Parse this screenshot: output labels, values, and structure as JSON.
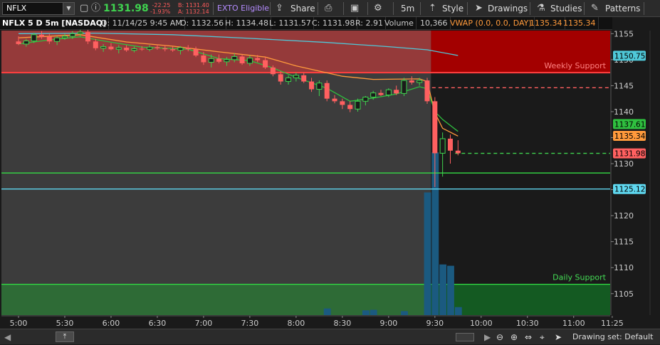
{
  "toolbar": {
    "symbol": "NFLX",
    "last_price": "1131.98",
    "net_change": "-22.25",
    "pct_change": "-1.93%",
    "bid": "B: 1131.40",
    "ask": "A: 1132.14",
    "exto_label": "EXTO Eligible",
    "share_label": "Share",
    "timeframe_label": "5m",
    "style_label": "Style",
    "drawings_label": "Drawings",
    "studies_label": "Studies",
    "patterns_label": "Patterns"
  },
  "header": {
    "title": "NFLX 5 D 5m [NASDAQ]",
    "date": "D: 11/14/25 9:45 AM",
    "open": "O: 1132.56",
    "high": "H: 1134.48",
    "low": "L: 1131.57",
    "close": "C: 1131.98",
    "range": "R: 2.91",
    "volume_label": "Volume",
    "volume_value": "10,366",
    "vwap_label": "VWAP (0.0, 0.0, DAY)",
    "vwap_value1": "1135.34",
    "vwap_value2": "1135.34"
  },
  "bottom": {
    "drawing_set": "Drawing set: Default"
  },
  "colors": {
    "up": "#3fd34f",
    "down": "#ff6060",
    "ema_fast": "#2fbf3f",
    "ema_slow": "#ff9a3c",
    "ma_long": "#4fc8d8",
    "support": "#33dd44",
    "cyan": "#5fd8f0"
  },
  "chart_data": {
    "type": "candlestick",
    "ylim": [
      1101,
      1156
    ],
    "y_ticks": [
      1105,
      1110,
      1115,
      1120,
      1125,
      1130,
      1135,
      1140,
      1145,
      1150,
      1155
    ],
    "x_ticks": [
      {
        "label": "5:00",
        "t": 0
      },
      {
        "label": "5:30",
        "t": 6
      },
      {
        "label": "6:00",
        "t": 12
      },
      {
        "label": "6:30",
        "t": 18
      },
      {
        "label": "7:00",
        "t": 24
      },
      {
        "label": "7:30",
        "t": 30
      },
      {
        "label": "8:00",
        "t": 36
      },
      {
        "label": "8:30",
        "t": 42
      },
      {
        "label": "9:00",
        "t": 48
      },
      {
        "label": "9:30",
        "t": 54
      },
      {
        "label": "10:00",
        "t": 60
      },
      {
        "label": "10:30",
        "t": 66
      },
      {
        "label": "11:00",
        "t": 72
      },
      {
        "label": "11:25",
        "t": 77
      }
    ],
    "session_open_t": 53,
    "candles": [
      {
        "t": 0,
        "o": 1153.5,
        "h": 1154.5,
        "l": 1152.8,
        "c": 1153.0
      },
      {
        "t": 1,
        "o": 1153.0,
        "h": 1154.0,
        "l": 1152.5,
        "c": 1153.6
      },
      {
        "t": 2,
        "o": 1153.6,
        "h": 1155.2,
        "l": 1153.2,
        "c": 1154.8
      },
      {
        "t": 3,
        "o": 1154.8,
        "h": 1155.5,
        "l": 1154.0,
        "c": 1154.4
      },
      {
        "t": 4,
        "o": 1154.4,
        "h": 1155.0,
        "l": 1153.0,
        "c": 1153.5
      },
      {
        "t": 5,
        "o": 1153.5,
        "h": 1154.5,
        "l": 1152.8,
        "c": 1154.2
      },
      {
        "t": 6,
        "o": 1154.2,
        "h": 1155.0,
        "l": 1153.8,
        "c": 1154.5
      },
      {
        "t": 7,
        "o": 1154.5,
        "h": 1155.5,
        "l": 1154.0,
        "c": 1155.0
      },
      {
        "t": 8,
        "o": 1155.0,
        "h": 1155.8,
        "l": 1154.5,
        "c": 1155.3
      },
      {
        "t": 9,
        "o": 1155.3,
        "h": 1155.8,
        "l": 1153.0,
        "c": 1153.5
      },
      {
        "t": 10,
        "o": 1153.5,
        "h": 1154.0,
        "l": 1151.8,
        "c": 1152.2
      },
      {
        "t": 11,
        "o": 1152.2,
        "h": 1153.0,
        "l": 1151.5,
        "c": 1152.5
      },
      {
        "t": 12,
        "o": 1152.5,
        "h": 1153.2,
        "l": 1151.8,
        "c": 1152.0
      },
      {
        "t": 13,
        "o": 1152.0,
        "h": 1152.8,
        "l": 1151.2,
        "c": 1152.3
      },
      {
        "t": 14,
        "o": 1152.3,
        "h": 1152.8,
        "l": 1151.5,
        "c": 1151.8
      },
      {
        "t": 15,
        "o": 1151.8,
        "h": 1152.5,
        "l": 1151.4,
        "c": 1152.1
      },
      {
        "t": 16,
        "o": 1152.1,
        "h": 1152.6,
        "l": 1151.7,
        "c": 1152.0
      },
      {
        "t": 17,
        "o": 1152.0,
        "h": 1152.8,
        "l": 1151.6,
        "c": 1152.4
      },
      {
        "t": 18,
        "o": 1152.4,
        "h": 1152.9,
        "l": 1151.9,
        "c": 1152.2
      },
      {
        "t": 19,
        "o": 1152.2,
        "h": 1152.8,
        "l": 1151.6,
        "c": 1152.0
      },
      {
        "t": 20,
        "o": 1152.0,
        "h": 1152.5,
        "l": 1151.5,
        "c": 1151.8
      },
      {
        "t": 21,
        "o": 1151.8,
        "h": 1152.6,
        "l": 1151.0,
        "c": 1152.3
      },
      {
        "t": 22,
        "o": 1152.3,
        "h": 1152.8,
        "l": 1151.6,
        "c": 1152.0
      },
      {
        "t": 23,
        "o": 1152.0,
        "h": 1152.5,
        "l": 1150.5,
        "c": 1150.8
      },
      {
        "t": 24,
        "o": 1150.8,
        "h": 1151.5,
        "l": 1149.0,
        "c": 1149.5
      },
      {
        "t": 25,
        "o": 1149.5,
        "h": 1151.0,
        "l": 1148.5,
        "c": 1150.2
      },
      {
        "t": 26,
        "o": 1150.2,
        "h": 1151.0,
        "l": 1149.3,
        "c": 1149.6
      },
      {
        "t": 27,
        "o": 1149.6,
        "h": 1150.5,
        "l": 1148.8,
        "c": 1150.0
      },
      {
        "t": 28,
        "o": 1150.0,
        "h": 1151.2,
        "l": 1149.5,
        "c": 1150.6
      },
      {
        "t": 29,
        "o": 1150.6,
        "h": 1151.0,
        "l": 1149.0,
        "c": 1149.3
      },
      {
        "t": 30,
        "o": 1149.3,
        "h": 1150.8,
        "l": 1148.8,
        "c": 1150.3
      },
      {
        "t": 31,
        "o": 1150.3,
        "h": 1150.9,
        "l": 1149.5,
        "c": 1149.9
      },
      {
        "t": 32,
        "o": 1149.9,
        "h": 1150.5,
        "l": 1148.2,
        "c": 1148.5
      },
      {
        "t": 33,
        "o": 1148.5,
        "h": 1148.9,
        "l": 1146.8,
        "c": 1147.2
      },
      {
        "t": 34,
        "o": 1147.2,
        "h": 1147.8,
        "l": 1145.2,
        "c": 1145.8
      },
      {
        "t": 35,
        "o": 1145.8,
        "h": 1147.0,
        "l": 1145.2,
        "c": 1146.5
      },
      {
        "t": 36,
        "o": 1146.5,
        "h": 1147.5,
        "l": 1145.8,
        "c": 1147.0
      },
      {
        "t": 37,
        "o": 1147.0,
        "h": 1147.5,
        "l": 1145.5,
        "c": 1145.8
      },
      {
        "t": 38,
        "o": 1145.8,
        "h": 1146.5,
        "l": 1143.8,
        "c": 1144.3
      },
      {
        "t": 39,
        "o": 1144.3,
        "h": 1146.0,
        "l": 1143.0,
        "c": 1145.5
      },
      {
        "t": 40,
        "o": 1145.5,
        "h": 1146.0,
        "l": 1142.0,
        "c": 1142.5
      },
      {
        "t": 41,
        "o": 1142.5,
        "h": 1143.2,
        "l": 1141.6,
        "c": 1142.0
      },
      {
        "t": 42,
        "o": 1142.0,
        "h": 1142.5,
        "l": 1140.5,
        "c": 1141.3
      },
      {
        "t": 43,
        "o": 1141.3,
        "h": 1142.0,
        "l": 1139.9,
        "c": 1140.5
      },
      {
        "t": 44,
        "o": 1140.5,
        "h": 1142.5,
        "l": 1140.0,
        "c": 1142.0
      },
      {
        "t": 45,
        "o": 1142.0,
        "h": 1143.0,
        "l": 1141.2,
        "c": 1142.8
      },
      {
        "t": 46,
        "o": 1142.8,
        "h": 1144.0,
        "l": 1142.3,
        "c": 1143.6
      },
      {
        "t": 47,
        "o": 1143.6,
        "h": 1144.2,
        "l": 1143.0,
        "c": 1143.2
      },
      {
        "t": 48,
        "o": 1143.2,
        "h": 1144.5,
        "l": 1142.8,
        "c": 1144.2
      },
      {
        "t": 49,
        "o": 1144.2,
        "h": 1145.0,
        "l": 1143.2,
        "c": 1143.5
      },
      {
        "t": 50,
        "o": 1143.5,
        "h": 1146.5,
        "l": 1143.0,
        "c": 1146.0
      },
      {
        "t": 51,
        "o": 1146.0,
        "h": 1146.8,
        "l": 1145.2,
        "c": 1145.6
      },
      {
        "t": 52,
        "o": 1145.6,
        "h": 1146.5,
        "l": 1145.0,
        "c": 1146.0
      },
      {
        "t": 53,
        "o": 1146.0,
        "h": 1146.5,
        "l": 1141.5,
        "c": 1142.0
      },
      {
        "t": 54,
        "o": 1142.0,
        "h": 1142.8,
        "l": 1125.5,
        "c": 1132.0
      },
      {
        "t": 55,
        "o": 1132.0,
        "h": 1136.0,
        "l": 1127.5,
        "c": 1134.8
      },
      {
        "t": 56,
        "o": 1134.8,
        "h": 1135.6,
        "l": 1130.0,
        "c": 1132.5
      },
      {
        "t": 57,
        "o": 1132.5,
        "h": 1134.5,
        "l": 1131.6,
        "c": 1132.0
      }
    ],
    "volume": [
      {
        "t": 40,
        "v": 2500
      },
      {
        "t": 45,
        "v": 1800
      },
      {
        "t": 46,
        "v": 2000
      },
      {
        "t": 50,
        "v": 1500
      },
      {
        "t": 53,
        "v": 46000
      },
      {
        "t": 54,
        "v": 61000
      },
      {
        "t": 55,
        "v": 19000
      },
      {
        "t": 56,
        "v": 18500
      },
      {
        "t": 57,
        "v": 3000
      }
    ],
    "volume_max": 72000,
    "ema_fast": [
      [
        0,
        1153.0
      ],
      [
        4,
        1153.8
      ],
      [
        8,
        1154.4
      ],
      [
        11,
        1153.6
      ],
      [
        16,
        1152.4
      ],
      [
        22,
        1152.0
      ],
      [
        26,
        1150.2
      ],
      [
        30,
        1149.8
      ],
      [
        33,
        1148.4
      ],
      [
        36,
        1146.6
      ],
      [
        40,
        1144.5
      ],
      [
        43,
        1142.0
      ],
      [
        46,
        1142.6
      ],
      [
        49,
        1143.4
      ],
      [
        52,
        1144.8
      ],
      [
        53,
        1144.4
      ],
      [
        54,
        1140.0
      ],
      [
        55,
        1138.5
      ],
      [
        57,
        1136.2
      ]
    ],
    "ema_slow": [
      [
        0,
        1154.2
      ],
      [
        8,
        1154.8
      ],
      [
        14,
        1153.4
      ],
      [
        20,
        1152.6
      ],
      [
        26,
        1151.5
      ],
      [
        32,
        1150.5
      ],
      [
        36,
        1148.8
      ],
      [
        42,
        1146.8
      ],
      [
        46,
        1146.2
      ],
      [
        52,
        1146.3
      ],
      [
        53,
        1145.8
      ],
      [
        54,
        1139.8
      ],
      [
        55,
        1136.8
      ],
      [
        57,
        1135.3
      ]
    ],
    "ma_long": [
      [
        0,
        1155.0
      ],
      [
        10,
        1155.1
      ],
      [
        20,
        1154.8
      ],
      [
        30,
        1154.1
      ],
      [
        40,
        1153.3
      ],
      [
        48,
        1152.5
      ],
      [
        53,
        1151.9
      ],
      [
        57,
        1150.8
      ]
    ],
    "weekly_support": {
      "label": "Weekly Support",
      "top": 1156,
      "bottom": 1147.5,
      "line": 1147.5
    },
    "daily_support": {
      "label": "Daily Support",
      "top": 1106.8,
      "bottom": 1101
    },
    "h_lines": [
      {
        "name": "red-dashed-level",
        "value": 1144.6,
        "style": "dashed",
        "color": "#ff6060",
        "from_t": 54
      },
      {
        "name": "current-price-dashed",
        "value": 1131.98,
        "style": "dashed",
        "color": "#3fd34f",
        "from_t": 57
      },
      {
        "name": "green-support-line",
        "value": 1128.2,
        "style": "solid",
        "color": "#33dd44",
        "from_t": 0
      },
      {
        "name": "cyan-level-line",
        "value": 1125.12,
        "style": "solid",
        "color": "#5fd8f0",
        "from_t": 0
      }
    ],
    "price_labels": [
      {
        "name": "ma-long-price-label",
        "value": 1150.75,
        "text": "1150.75",
        "color": "#4fc8d8"
      },
      {
        "name": "ema-fast-price-label",
        "value": 1137.61,
        "text": "1137.61",
        "color": "#2fbf3f"
      },
      {
        "name": "vwap-price-label",
        "value": 1135.34,
        "text": "1135.34",
        "color": "#ff9a3c"
      },
      {
        "name": "last-price-label",
        "value": 1131.98,
        "text": "1131.98",
        "color": "#ff6060"
      },
      {
        "name": "cyan-level-price-label",
        "value": 1125.12,
        "text": "1125.12",
        "color": "#5fd8f0"
      }
    ]
  }
}
